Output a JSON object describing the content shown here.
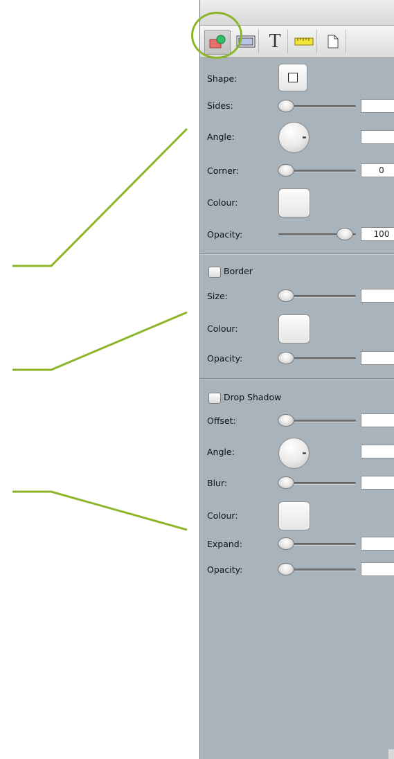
{
  "toolbar": {
    "tools": [
      {
        "name": "shape-tab",
        "icon": "shape-icon",
        "selected": true
      },
      {
        "name": "frame-tab",
        "icon": "frame-icon"
      },
      {
        "name": "text-tab",
        "icon": "text-icon",
        "label": "T"
      },
      {
        "name": "ruler-tab",
        "icon": "ruler-icon"
      },
      {
        "name": "document-tab",
        "icon": "document-icon"
      }
    ]
  },
  "shape_section": {
    "shape_label": "Shape:",
    "sides_label": "Sides:",
    "sides_value": "",
    "angle_label": "Angle:",
    "angle_value": "",
    "corner_label": "Corner:",
    "corner_value": "0",
    "colour_label": "Colour:",
    "opacity_label": "Opacity:",
    "opacity_value": "100"
  },
  "border_section": {
    "header": "Border",
    "checked": false,
    "size_label": "Size:",
    "size_value": "",
    "colour_label": "Colour:",
    "opacity_label": "Opacity:",
    "opacity_value": ""
  },
  "shadow_section": {
    "header": "Drop Shadow",
    "checked": false,
    "offset_label": "Offset:",
    "offset_value": "",
    "angle_label": "Angle:",
    "angle_value": "",
    "blur_label": "Blur:",
    "blur_value": "",
    "colour_label": "Colour:",
    "expand_label": "Expand:",
    "expand_value": "",
    "opacity_label": "Opacity:",
    "opacity_value": ""
  },
  "colors": {
    "panel_bg": "#a9b3bc",
    "callout": "#8cb52a"
  }
}
